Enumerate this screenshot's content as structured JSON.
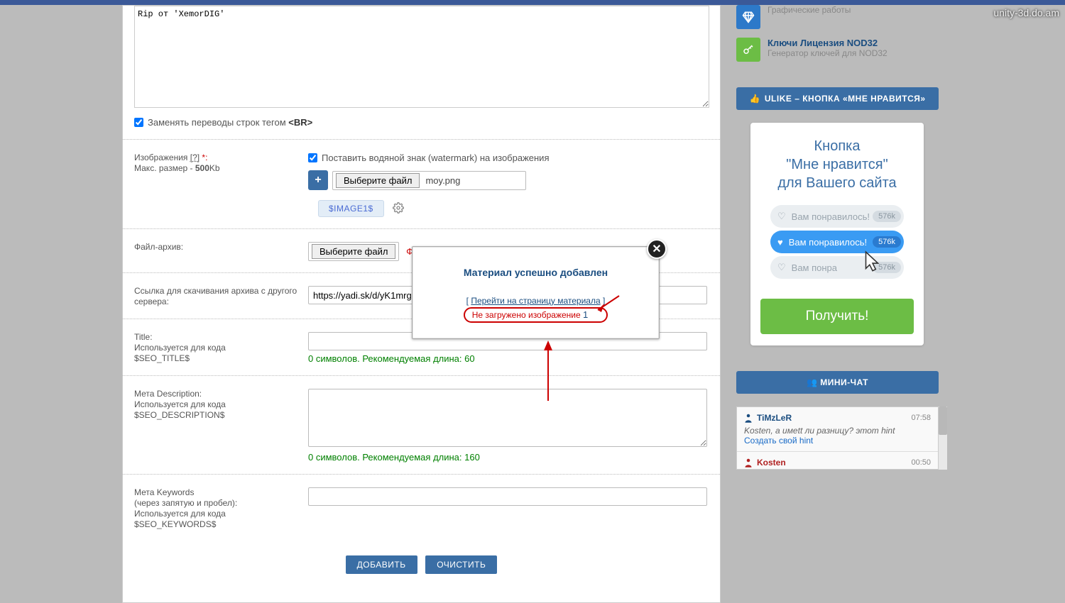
{
  "watermark": "unity-3d.do.am",
  "form": {
    "textarea_value": "Rip от 'XemorDIG'",
    "br_checkbox_label": "Заменять переводы строк тегом ",
    "br_tag": "<BR>",
    "watermark_label": "Поставить водяной знак (watermark) на изображения",
    "choose_file": "Выберите файл",
    "chosen_file": "moy.png",
    "images_label": "Изображения ",
    "images_q": "[?]",
    "images_star": " *:",
    "max_size_label": "Макс. размер - ",
    "max_size_value": "500",
    "max_size_unit": "Kb",
    "image_pill": "$IMAGE1$",
    "archive_label": "Файл-архив:",
    "archive_err": "Фай",
    "link_label": "Ссылка для скачивания архива с другого сервера:",
    "link_value": "https://yadi.sk/d/yK1mrg",
    "title_label_1": "Title:",
    "title_label_2": "Используется для кода",
    "title_label_3": "$SEO_TITLE$",
    "title_hint": "0 символов. Рекомендуемая длина: 60",
    "desc_label_1": "Мета Description:",
    "desc_label_2": "Используется для кода",
    "desc_label_3": "$SEO_DESCRIPTION$",
    "desc_hint": "0 символов. Рекомендуемая длина: 160",
    "kw_label_1": "Мета Keywords",
    "kw_label_2": "(через запятую и пробел):",
    "kw_label_3": "Используется для кода",
    "kw_label_4": "$SEO_KEYWORDS$",
    "submit_btn": "ДОБАВИТЬ",
    "clear_btn": "ОЧИСТИТЬ"
  },
  "modal": {
    "title": "Материал успешно добавлен",
    "link_text": "Перейти на страницу материала",
    "error_text": "Не загружено изображение ",
    "error_num": "1"
  },
  "sidebar": {
    "items": [
      {
        "title": "",
        "sub": "Графические работы"
      },
      {
        "title": "Ключи Лицензия NOD32",
        "sub": "Генератор ключей для NOD32"
      }
    ],
    "ulike_header": "ULIKE – КНОПКА «МНЕ НРАВИТСЯ»",
    "ulike_card": {
      "line1": "Кнопка",
      "line2": "\"Мне нравится\"",
      "line3": "для Вашего сайта",
      "pill_text": "Вам понравилось!",
      "pill_text_cut": "Вам понра",
      "count": "576k",
      "get_btn": "Получить!"
    },
    "chat_header": "МИНИ-ЧАТ",
    "chat": {
      "msg1_user": "TiMzLeR",
      "msg1_time": "07:58",
      "msg1_body": "Kosten, а имett ли разницу? этот hint",
      "msg1_link": "Создать свой hint",
      "msg2_user": "Kosten",
      "msg2_time": "00:50"
    }
  }
}
